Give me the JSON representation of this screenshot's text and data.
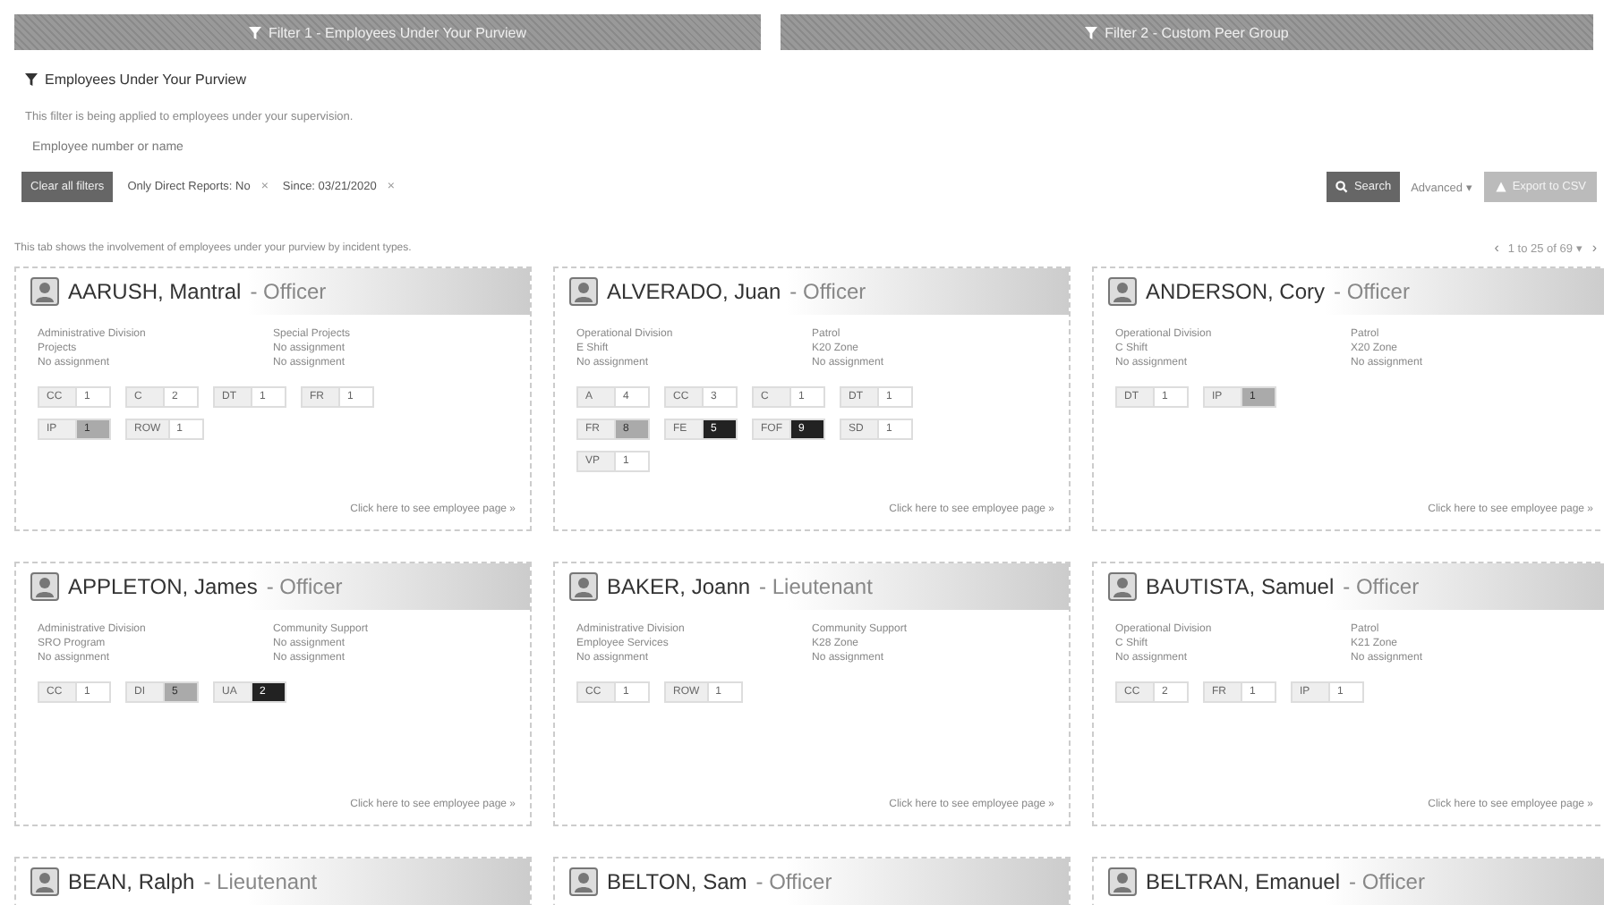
{
  "filter_bars": [
    {
      "label": "Filter 1 - Employees Under Your Purview"
    },
    {
      "label": "Filter 2 - Custom Peer Group"
    }
  ],
  "section": {
    "title": "Employees Under Your Purview",
    "description": "This filter is being applied to employees under your supervision.",
    "search": {
      "placeholder": "Employee number or name"
    },
    "clear_button": "Clear all filters",
    "chips": [
      {
        "label": "Only Direct Reports: No",
        "remove": "×"
      },
      {
        "label": "Since: 03/21/2020",
        "remove": "×"
      }
    ],
    "search_button": "Search",
    "advanced": "Advanced",
    "advanced_caret": "▾",
    "export_button": {
      "label": "Export to CSV",
      "disabled": true
    }
  },
  "summary": "This tab shows the involvement of employees under your purview by incident types.",
  "pagination": {
    "prev": "‹",
    "range": "1 to 25 of 69",
    "caret": "▾",
    "next": "›"
  },
  "cards": [
    {
      "name": "AARUSH, Mantral",
      "role": "- Officer",
      "info": [
        [
          "Administrative Division",
          "Special Projects"
        ],
        [
          "Projects",
          "No assignment"
        ],
        [
          "No assignment",
          "No assignment"
        ]
      ],
      "badges": [
        {
          "label": "CC",
          "count": "1",
          "color": "#ffffff"
        },
        {
          "label": "C",
          "count": "2",
          "color": "#ffffff"
        },
        {
          "label": "DT",
          "count": "1",
          "color": "#ffffff"
        },
        {
          "label": "FR",
          "count": "1",
          "color": "#ffffff"
        },
        {
          "label": "IP",
          "count": "1",
          "color": "#aaaaaa"
        },
        {
          "label": "ROW",
          "count": "1",
          "color": "#ffffff"
        }
      ],
      "link": "Click here to see employee page »"
    },
    {
      "name": "ALVERADO, Juan",
      "role": "- Officer",
      "info": [
        [
          "Operational Division",
          "Patrol"
        ],
        [
          "E Shift",
          "K20 Zone"
        ],
        [
          "No assignment",
          "No assignment"
        ]
      ],
      "badges": [
        {
          "label": "A",
          "count": "4",
          "color": "#ffffff"
        },
        {
          "label": "CC",
          "count": "3",
          "color": "#ffffff"
        },
        {
          "label": "C",
          "count": "1",
          "color": "#ffffff"
        },
        {
          "label": "DT",
          "count": "1",
          "color": "#ffffff"
        },
        {
          "label": "FR",
          "count": "8",
          "color": "#aaaaaa"
        },
        {
          "label": "FE",
          "count": "5",
          "color": "#222222"
        },
        {
          "label": "FOF",
          "count": "9",
          "color": "#222222"
        },
        {
          "label": "SD",
          "count": "1",
          "color": "#ffffff"
        },
        {
          "label": "VP",
          "count": "1",
          "color": "#ffffff"
        }
      ],
      "link": "Click here to see employee page »"
    },
    {
      "name": "ANDERSON, Cory",
      "role": "- Officer",
      "info": [
        [
          "Operational Division",
          "Patrol"
        ],
        [
          "C Shift",
          "X20 Zone"
        ],
        [
          "No assignment",
          "No assignment"
        ]
      ],
      "badges": [
        {
          "label": "DT",
          "count": "1",
          "color": "#ffffff"
        },
        {
          "label": "IP",
          "count": "1",
          "color": "#aaaaaa"
        }
      ],
      "link": "Click here to see employee page »"
    },
    {
      "name": "APPLETON, James",
      "role": "- Officer",
      "info": [
        [
          "Administrative Division",
          "Community Support"
        ],
        [
          "SRO Program",
          "No assignment"
        ],
        [
          "No assignment",
          "No assignment"
        ]
      ],
      "badges": [
        {
          "label": "CC",
          "count": "1",
          "color": "#ffffff"
        },
        {
          "label": "DI",
          "count": "5",
          "color": "#aaaaaa"
        },
        {
          "label": "UA",
          "count": "2",
          "color": "#222222"
        }
      ],
      "link": "Click here to see employee page »"
    },
    {
      "name": "BAKER, Joann",
      "role": "- Lieutenant",
      "info": [
        [
          "Administrative Division",
          "Community Support"
        ],
        [
          "Employee Services",
          "K28 Zone"
        ],
        [
          "No assignment",
          "No assignment"
        ]
      ],
      "badges": [
        {
          "label": "CC",
          "count": "1",
          "color": "#ffffff"
        },
        {
          "label": "ROW",
          "count": "1",
          "color": "#ffffff"
        }
      ],
      "link": "Click here to see employee page »"
    },
    {
      "name": "BAUTISTA, Samuel",
      "role": "- Officer",
      "info": [
        [
          "Operational Division",
          "Patrol"
        ],
        [
          "C Shift",
          "K21 Zone"
        ],
        [
          "No assignment",
          "No assignment"
        ]
      ],
      "badges": [
        {
          "label": "CC",
          "count": "2",
          "color": "#ffffff"
        },
        {
          "label": "FR",
          "count": "1",
          "color": "#ffffff"
        },
        {
          "label": "IP",
          "count": "1",
          "color": "#ffffff"
        }
      ],
      "link": "Click here to see employee page »"
    },
    {
      "name": "BEAN, Ralph",
      "role": "- Lieutenant"
    },
    {
      "name": "BELTON, Sam",
      "role": "- Officer"
    },
    {
      "name": "BELTRAN, Emanuel",
      "role": "- Officer"
    }
  ]
}
